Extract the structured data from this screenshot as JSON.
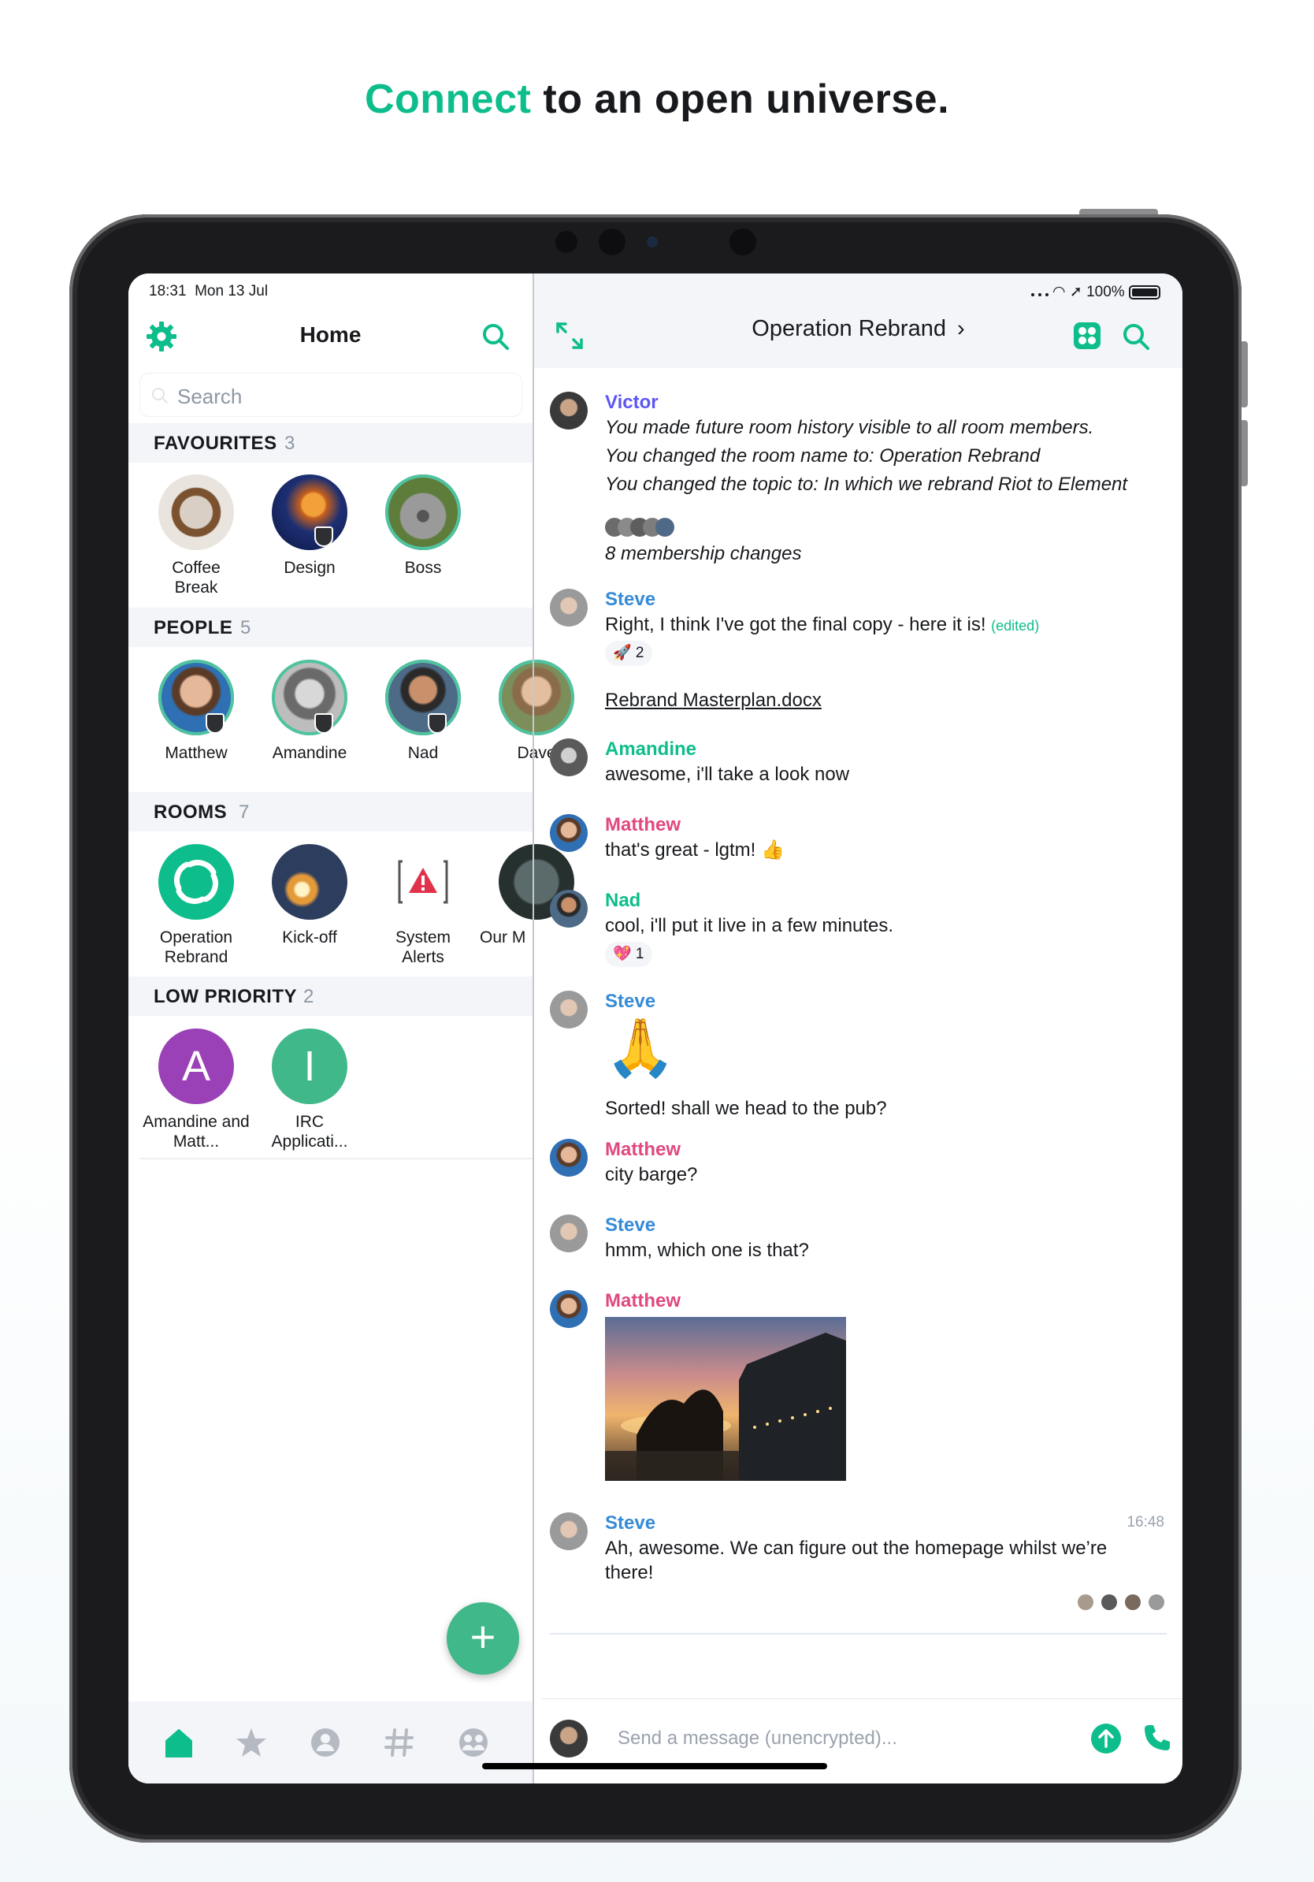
{
  "headline": {
    "accent": "Connect",
    "rest": " to an open universe."
  },
  "status_bar": {
    "time": "18:31",
    "date": "Mon 13 Jul",
    "battery": "100%"
  },
  "left": {
    "title": "Home",
    "search_placeholder": "Search",
    "sections": [
      {
        "title": "FAVOURITES",
        "count": "3"
      },
      {
        "title": "PEOPLE",
        "count": "5"
      },
      {
        "title": "ROOMS",
        "count": "7"
      },
      {
        "title": "LOW PRIORITY",
        "count": "2"
      }
    ],
    "favourites": [
      "Coffee Break",
      "Design",
      "Boss"
    ],
    "people": [
      "Matthew",
      "Amandine",
      "Nad",
      "Dave"
    ],
    "rooms": [
      "Operation Rebrand",
      "Kick-off",
      "System Alerts",
      "Our M"
    ],
    "low_priority": [
      {
        "label": "Amandine and Matt...",
        "letter": "A",
        "color": "#9b41b8"
      },
      {
        "label": "IRC Applicati...",
        "letter": "I",
        "color": "#40b889"
      }
    ],
    "fab_label": "+"
  },
  "right": {
    "room_title": "Operation Rebrand",
    "messages": [
      {
        "sender": "Victor",
        "lines": [
          "You made future room history visible to all room members.",
          "You changed the room name to: Operation Rebrand",
          "You changed the topic to: In which we rebrand Riot to Element"
        ]
      },
      {
        "membership": "8 membership changes"
      },
      {
        "sender": "Steve",
        "text": "Right, I think I've got the final copy - here it is!",
        "edited": "(edited)",
        "reaction": "🚀 2",
        "file": "Rebrand Masterplan.docx"
      },
      {
        "sender": "Amandine",
        "text": "awesome, i'll take a look now"
      },
      {
        "sender": "Matthew",
        "text": "that's great - lgtm! 👍"
      },
      {
        "sender": "Nad",
        "text": "cool, i'll put it live in a few minutes.",
        "reaction": "💖 1"
      },
      {
        "sender": "Steve",
        "emoji": "🙏",
        "text": "Sorted! shall we head to the pub?"
      },
      {
        "sender": "Matthew",
        "text": "city barge?"
      },
      {
        "sender": "Steve",
        "text": "hmm, which one is that?"
      },
      {
        "sender": "Matthew",
        "image": "sunset-photo"
      },
      {
        "sender": "Steve",
        "time": "16:48",
        "text": "Ah, awesome. We can figure out the homepage whilst we’re there!"
      }
    ],
    "composer_placeholder": "Send a message (unencrypted)..."
  },
  "colors": {
    "accent": "#0dbd8b",
    "victor": "#5c56f5",
    "steve": "#368bd6",
    "matthew": "#e0487f"
  }
}
